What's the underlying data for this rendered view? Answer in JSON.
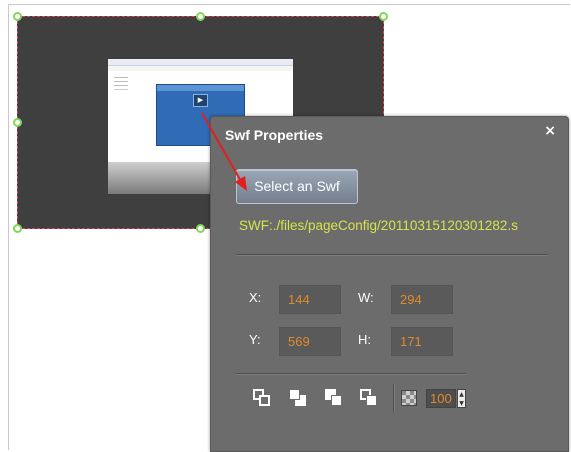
{
  "swf_properties": {
    "title": "Swf Properties",
    "close_label": "×",
    "select_button_label": "Select an Swf",
    "swf_path": "SWF:./files/pageConfig/20110315120301282.s",
    "fields": {
      "x_label": "X:",
      "x_value": "144",
      "w_label": "W:",
      "w_value": "294",
      "y_label": "Y:",
      "y_value": "569",
      "h_label": "H:",
      "h_value": "171"
    },
    "opacity_value": "100",
    "spinner_glyph": "▲▼"
  },
  "icons": {
    "close": "close-icon",
    "bring_to_front": "bring-to-front-icon",
    "send_to_back": "send-to-back-icon",
    "bring_forward": "bring-forward-icon",
    "send_backward": "send-backward-icon",
    "opacity": "opacity-icon",
    "play": "play-icon"
  },
  "colors": {
    "path_text": "#d9e24a",
    "field_value": "#e08a2e",
    "selection_border": "#e0405a",
    "handle": "#7ed957",
    "arrow": "#e02020"
  }
}
